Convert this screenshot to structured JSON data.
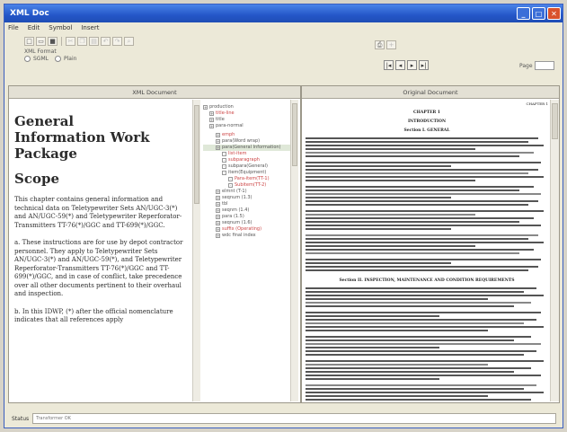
{
  "window": {
    "title": "XML Doc"
  },
  "menu": [
    "File",
    "Edit",
    "Symbol",
    "Insert"
  ],
  "toolbar": {
    "group_label": "XML Format",
    "radio_a": "SGML",
    "radio_b": "Plain"
  },
  "nav": {
    "first": "|◂",
    "prev": "◂",
    "next": "▸",
    "last": "▸|",
    "page_label": "Page"
  },
  "panes": {
    "left_header": "XML Document",
    "right_header": "Original Document"
  },
  "xml_document": {
    "title_lines": [
      "General",
      "Information Work",
      "Package"
    ],
    "heading": "Scope",
    "paragraphs": [
      "This chapter contains general information and technical data on Teletypewriter Sets AN/UGC-3(*) and AN/UGC-59(*) and Teletypewriter Reperforator-Transmitters TT-76(*)/GGC and TT-699(*)/GGC.",
      "a. These instructions are for use by depot contractor personnel. They apply to Teletypewriter Sets AN/UGC-3(*) and AN/UGC-59(*), and Teletypewriter Reperforator-Transmitters TT-76(*)/GGC and TT-699(*)/GGC, and in case of conflict, take precedence over all other documents pertinent to their overhaul and inspection.",
      "b. In this IDWP, (*) after the official nomenclature indicates that all references apply"
    ]
  },
  "tree": [
    {
      "label": "production",
      "level": 0,
      "red": false
    },
    {
      "label": "title-line",
      "level": 1,
      "red": true
    },
    {
      "label": "title",
      "level": 1,
      "red": false
    },
    {
      "label": "para-normal",
      "level": 1,
      "red": false
    },
    {
      "label": "emph",
      "level": 2,
      "red": true
    },
    {
      "label": "para(Word wrap)",
      "level": 2,
      "red": false
    },
    {
      "label": "para(General Information)",
      "level": 2,
      "red": false
    },
    {
      "label": "list-item",
      "level": 3,
      "red": true
    },
    {
      "label": "subparagraph",
      "level": 3,
      "red": true
    },
    {
      "label": "subpara(General)",
      "level": 3,
      "red": false
    },
    {
      "label": "item(Equipment)",
      "level": 3,
      "red": false
    },
    {
      "label": "Para-item(TT-1)",
      "level": 4,
      "red": true
    },
    {
      "label": "Subitem(TT-2)",
      "level": 4,
      "red": true
    },
    {
      "label": "elmnt (T-1)",
      "level": 2,
      "red": false
    },
    {
      "label": "seqnum (1.3)",
      "level": 2,
      "red": false
    },
    {
      "label": "tbl",
      "level": 2,
      "red": false
    },
    {
      "label": "seqnm (1.4)",
      "level": 2,
      "red": false
    },
    {
      "label": "para (1.5)",
      "level": 2,
      "red": false
    },
    {
      "label": "seqnum (1.6)",
      "level": 2,
      "red": false
    },
    {
      "label": "suffix (Operating)",
      "level": 2,
      "red": true
    },
    {
      "label": "wdc final index",
      "level": 2,
      "red": false
    }
  ],
  "original_document": {
    "header_right": "CHAPTER 1",
    "chapter": "CHAPTER 1",
    "intro": "INTRODUCTION",
    "section1": "Section I.  GENERAL",
    "section2": "Section II.  INSPECTION, MAINTENANCE AND CONDITION REQUIREMENTS"
  },
  "status": {
    "label": "Status",
    "value": "Transformer OK"
  }
}
